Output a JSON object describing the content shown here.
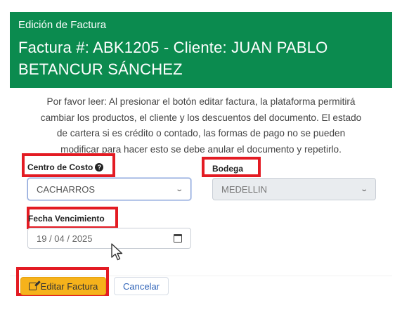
{
  "header": {
    "subtitle": "Edición de Factura",
    "title_line1": "Factura #: ABK1205 - Cliente: JUAN PABLO",
    "title_line2": "BETANCUR SÁNCHEZ"
  },
  "notice": {
    "line1": "Por favor leer: Al presionar el botón editar factura, la plataforma permitirá",
    "line2": "cambiar los productos, el cliente y los descuentos del documento. El estado",
    "line3": "de cartera si es crédito o contado, las formas de pago no se pueden",
    "line4": "modificar para hacer esto se debe anular el documento y repetirlo."
  },
  "form": {
    "cost_center_label": "Centro de Costo",
    "cost_center_value": "CACHARROS",
    "warehouse_label": "Bodega",
    "warehouse_value": "MEDELLIN",
    "due_date_label": "Fecha Vencimiento",
    "due_date_value": "19 / 04 / 2025"
  },
  "buttons": {
    "edit_label": "Editar Factura",
    "cancel_label": "Cancelar"
  },
  "colors": {
    "header_bg": "#0b8b4f",
    "highlight": "#e31b23",
    "edit_button": "#f6b21b",
    "cancel_text": "#2f63b8"
  },
  "icons": [
    "question-circle-icon",
    "chevron-down-icon",
    "calendar-icon",
    "edit-icon",
    "mouse-cursor-icon"
  ]
}
